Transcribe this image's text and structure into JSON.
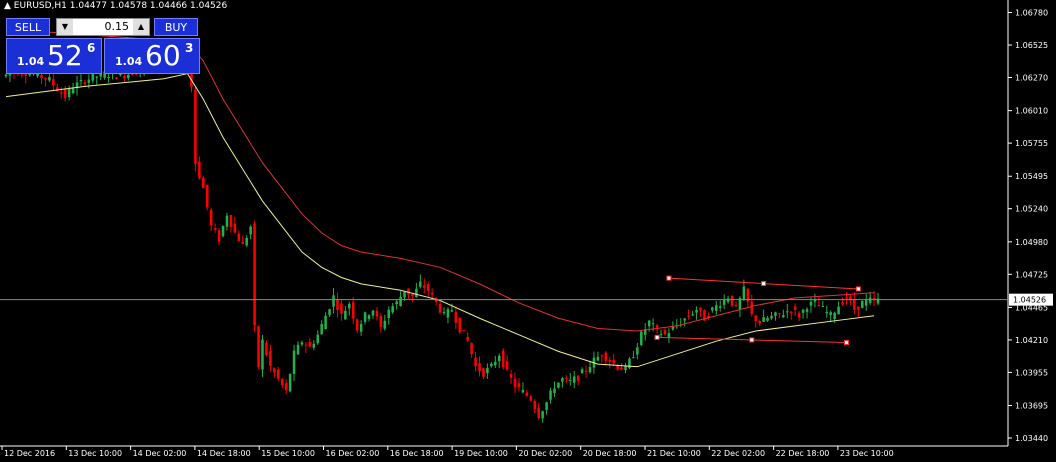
{
  "header": {
    "symbol_line": "EURUSD,H1 1.04477 1.04578 1.04466 1.04526",
    "arrow": "▲"
  },
  "trade_panel": {
    "sell_label": "SELL",
    "buy_label": "BUY",
    "lot": "0.15",
    "lot_down": "▼",
    "lot_up": "▲",
    "bid_prefix": "1.04",
    "bid_big": "52",
    "bid_pip": "6",
    "ask_prefix": "1.04",
    "ask_big": "60",
    "ask_pip": "3",
    "color": "#1a2fd6"
  },
  "chart_data": {
    "type": "candlestick",
    "symbol": "EURUSD",
    "timeframe": "H1",
    "ylim": [
      1.0344,
      1.068
    ],
    "y_ticks": [
      "1.06780",
      "1.06525",
      "1.06270",
      "1.06010",
      "1.05755",
      "1.05495",
      "1.05240",
      "1.04980",
      "1.04725",
      "1.04465",
      "1.04210",
      "1.03955",
      "1.03695",
      "1.03440"
    ],
    "x_ticks": [
      "12 Dec 2016",
      "13 Dec 10:00",
      "14 Dec 02:00",
      "14 Dec 18:00",
      "15 Dec 10:00",
      "16 Dec 02:00",
      "16 Dec 18:00",
      "19 Dec 10:00",
      "20 Dec 02:00",
      "20 Dec 18:00",
      "21 Dec 10:00",
      "22 Dec 02:00",
      "22 Dec 18:00",
      "23 Dec 10:00"
    ],
    "current_price": "1.04526",
    "colors": {
      "bull": "#22b14c",
      "bear": "#ff0000",
      "ma_slow": "#e03030",
      "ma_fast": "#f0f090",
      "axis": "#ffffff",
      "channel": "#ff3030"
    },
    "close_path": [
      [
        0,
        1.0628
      ],
      [
        4,
        1.0632
      ],
      [
        8,
        1.063
      ],
      [
        12,
        1.0625
      ],
      [
        14,
        1.0618
      ],
      [
        16,
        1.0612
      ],
      [
        18,
        1.062
      ],
      [
        22,
        1.0626
      ],
      [
        26,
        1.063
      ],
      [
        30,
        1.0628
      ],
      [
        34,
        1.0632
      ],
      [
        38,
        1.064
      ],
      [
        42,
        1.0644
      ],
      [
        46,
        1.065
      ],
      [
        48,
        1.062
      ],
      [
        49,
        1.056
      ],
      [
        51,
        1.054
      ],
      [
        53,
        1.051
      ],
      [
        55,
        1.05
      ],
      [
        57,
        1.052
      ],
      [
        59,
        1.0505
      ],
      [
        61,
        1.0495
      ],
      [
        63,
        1.051
      ],
      [
        64,
        1.043
      ],
      [
        65,
        1.04
      ],
      [
        66,
        1.042
      ],
      [
        68,
        1.04
      ],
      [
        70,
        1.039
      ],
      [
        72,
        1.038
      ],
      [
        74,
        1.041
      ],
      [
        76,
        1.042
      ],
      [
        78,
        1.0415
      ],
      [
        80,
        1.0425
      ],
      [
        82,
        1.044
      ],
      [
        84,
        1.0455
      ],
      [
        86,
        1.044
      ],
      [
        88,
        1.045
      ],
      [
        90,
        1.043
      ],
      [
        92,
        1.044
      ],
      [
        94,
        1.0445
      ],
      [
        96,
        1.043
      ],
      [
        98,
        1.0445
      ],
      [
        100,
        1.045
      ],
      [
        102,
        1.046
      ],
      [
        104,
        1.0455
      ],
      [
        106,
        1.0465
      ],
      [
        108,
        1.046
      ],
      [
        110,
        1.045
      ],
      [
        112,
        1.044
      ],
      [
        114,
        1.0445
      ],
      [
        116,
        1.043
      ],
      [
        118,
        1.042
      ],
      [
        120,
        1.04
      ],
      [
        122,
        1.0395
      ],
      [
        124,
        1.04
      ],
      [
        126,
        1.041
      ],
      [
        128,
        1.0395
      ],
      [
        130,
        1.0385
      ],
      [
        132,
        1.038
      ],
      [
        134,
        1.0375
      ],
      [
        136,
        1.0362
      ],
      [
        138,
        1.0372
      ],
      [
        140,
        1.0385
      ],
      [
        142,
        1.039
      ],
      [
        144,
        1.0388
      ],
      [
        146,
        1.0392
      ],
      [
        148,
        1.0398
      ],
      [
        150,
        1.0405
      ],
      [
        152,
        1.041
      ],
      [
        154,
        1.0405
      ],
      [
        156,
        1.04
      ],
      [
        158,
        1.0398
      ],
      [
        160,
        1.041
      ],
      [
        162,
        1.0425
      ],
      [
        164,
        1.0435
      ],
      [
        166,
        1.0428
      ],
      [
        168,
        1.0425
      ],
      [
        170,
        1.043
      ],
      [
        172,
        1.0435
      ],
      [
        174,
        1.044
      ],
      [
        176,
        1.0445
      ],
      [
        178,
        1.0438
      ],
      [
        180,
        1.0445
      ],
      [
        182,
        1.045
      ],
      [
        184,
        1.0455
      ],
      [
        186,
        1.0445
      ],
      [
        188,
        1.046
      ],
      [
        190,
        1.044
      ],
      [
        192,
        1.0435
      ],
      [
        194,
        1.0438
      ],
      [
        196,
        1.044
      ],
      [
        198,
        1.0442
      ],
      [
        200,
        1.0445
      ],
      [
        202,
        1.044
      ],
      [
        204,
        1.0448
      ],
      [
        206,
        1.045
      ],
      [
        208,
        1.0445
      ],
      [
        210,
        1.044
      ],
      [
        212,
        1.0448
      ],
      [
        214,
        1.0455
      ],
      [
        216,
        1.0445
      ],
      [
        218,
        1.045
      ],
      [
        220,
        1.0452
      ]
    ],
    "ma_slow": [
      [
        0,
        1.0665
      ],
      [
        46,
        1.0655
      ],
      [
        50,
        1.064
      ],
      [
        55,
        1.061
      ],
      [
        60,
        1.0585
      ],
      [
        65,
        1.056
      ],
      [
        70,
        1.054
      ],
      [
        75,
        1.052
      ],
      [
        80,
        1.0505
      ],
      [
        85,
        1.0495
      ],
      [
        90,
        1.049
      ],
      [
        100,
        1.0485
      ],
      [
        110,
        1.0478
      ],
      [
        120,
        1.0465
      ],
      [
        130,
        1.045
      ],
      [
        140,
        1.0438
      ],
      [
        150,
        1.043
      ],
      [
        160,
        1.0428
      ],
      [
        170,
        1.0432
      ],
      [
        180,
        1.044
      ],
      [
        190,
        1.0448
      ],
      [
        200,
        1.0454
      ],
      [
        210,
        1.0456
      ],
      [
        220,
        1.0458
      ]
    ],
    "ma_fast": [
      [
        0,
        1.0612
      ],
      [
        20,
        1.062
      ],
      [
        40,
        1.0626
      ],
      [
        46,
        1.063
      ],
      [
        50,
        1.061
      ],
      [
        55,
        1.058
      ],
      [
        60,
        1.0555
      ],
      [
        65,
        1.053
      ],
      [
        70,
        1.051
      ],
      [
        75,
        1.049
      ],
      [
        80,
        1.0478
      ],
      [
        85,
        1.047
      ],
      [
        90,
        1.0465
      ],
      [
        100,
        1.046
      ],
      [
        110,
        1.0452
      ],
      [
        120,
        1.0438
      ],
      [
        130,
        1.0425
      ],
      [
        140,
        1.0412
      ],
      [
        150,
        1.0402
      ],
      [
        160,
        1.04
      ],
      [
        170,
        1.041
      ],
      [
        180,
        1.042
      ],
      [
        190,
        1.0428
      ],
      [
        200,
        1.0432
      ],
      [
        210,
        1.0436
      ],
      [
        220,
        1.044
      ]
    ],
    "channel_upper": [
      [
        168,
        1.04695
      ],
      [
        216,
        1.0461
      ]
    ],
    "channel_lower": [
      [
        165,
        1.0423
      ],
      [
        213,
        1.0419
      ]
    ]
  }
}
